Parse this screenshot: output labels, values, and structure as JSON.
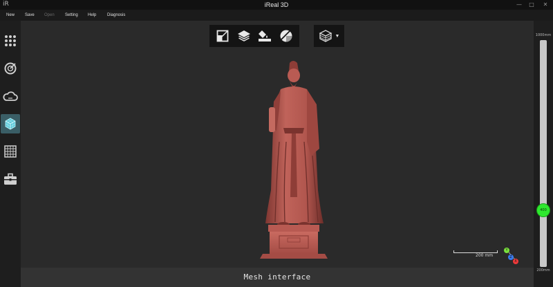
{
  "window": {
    "logo_text": "iR",
    "title": "iReal 3D",
    "minimize": "—",
    "maximize": "□",
    "close": "✕"
  },
  "menu": {
    "items": [
      {
        "label": "New",
        "enabled": true
      },
      {
        "label": "Save",
        "enabled": true
      },
      {
        "label": "Open",
        "enabled": false
      },
      {
        "label": "Setting",
        "enabled": true
      },
      {
        "label": "Help",
        "enabled": true
      },
      {
        "label": "Diagnosis",
        "enabled": true
      }
    ]
  },
  "sidebar": {
    "items": [
      {
        "icon": "grid-dots-icon",
        "active": false
      },
      {
        "icon": "scan-target-icon",
        "active": false
      },
      {
        "icon": "cloud-icon",
        "active": false
      },
      {
        "icon": "mesh-cube-icon",
        "active": true
      },
      {
        "icon": "texture-grid-icon",
        "active": false
      },
      {
        "icon": "toolbox-icon",
        "active": false
      }
    ]
  },
  "toolbar": {
    "tools": [
      "frame-crop-icon",
      "layers-stack-icon",
      "paint-bucket-icon",
      "slice-circle-icon"
    ],
    "view_dropdown_icon": "layers-cube-icon"
  },
  "viewport": {
    "scale_label": "200 mm",
    "axis_labels": {
      "y": "Y",
      "z": "Z",
      "x": "X"
    },
    "model_color": "#b85a52"
  },
  "status": {
    "text": "Mesh interface"
  },
  "zoom": {
    "max_label": "1000mm",
    "min_label": "200mm",
    "value_label": "400",
    "level": 0.25,
    "thumb_color": "#2ee82e"
  }
}
